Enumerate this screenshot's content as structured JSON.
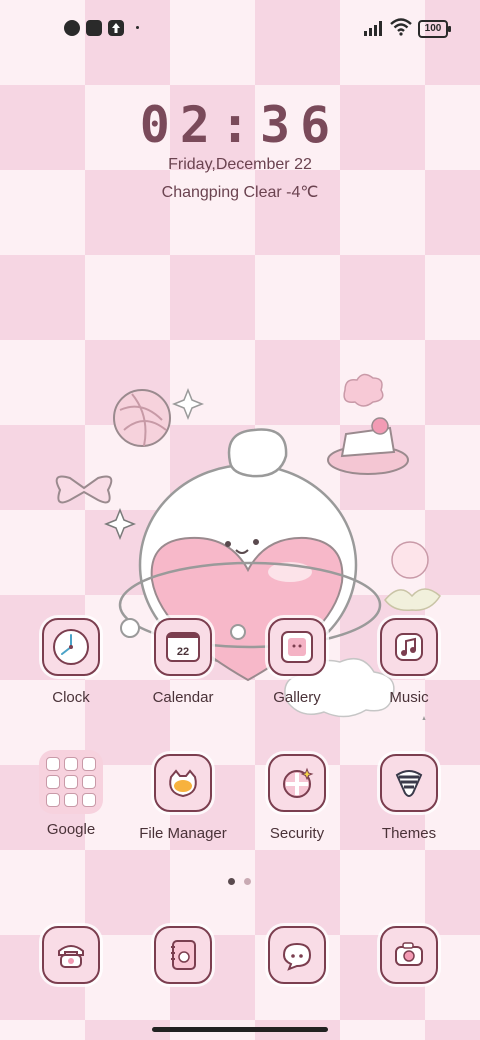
{
  "status_bar": {
    "battery": "100",
    "left_icons": [
      "app-notification-icon",
      "square-notification-icon",
      "upload-notification-icon"
    ],
    "right_icons": [
      "signal-icon",
      "wifi-icon",
      "battery-icon"
    ]
  },
  "clock_widget": {
    "time": "02:36",
    "date": "Friday,December 22",
    "weather": "Changping Clear -4℃"
  },
  "apps_row1": [
    {
      "label": "Clock",
      "icon": "clock-icon"
    },
    {
      "label": "Calendar",
      "icon": "calendar-icon",
      "badge": "22"
    },
    {
      "label": "Gallery",
      "icon": "gallery-icon"
    },
    {
      "label": "Music",
      "icon": "music-icon"
    }
  ],
  "apps_row2": [
    {
      "label": "Google",
      "icon": "google-folder-icon"
    },
    {
      "label": "File Manager",
      "icon": "file-manager-icon"
    },
    {
      "label": "Security",
      "icon": "security-icon"
    },
    {
      "label": "Themes",
      "icon": "themes-icon"
    }
  ],
  "dock": [
    {
      "icon": "phone-icon"
    },
    {
      "icon": "contacts-icon"
    },
    {
      "icon": "messages-icon"
    },
    {
      "icon": "camera-icon"
    }
  ],
  "pager": {
    "pages": 2,
    "current": 1
  },
  "colors": {
    "accent": "#7b3e4f",
    "icon_bg": "#f9dce6",
    "background": "#fdf0f4",
    "checker": "#f6d6e3"
  }
}
